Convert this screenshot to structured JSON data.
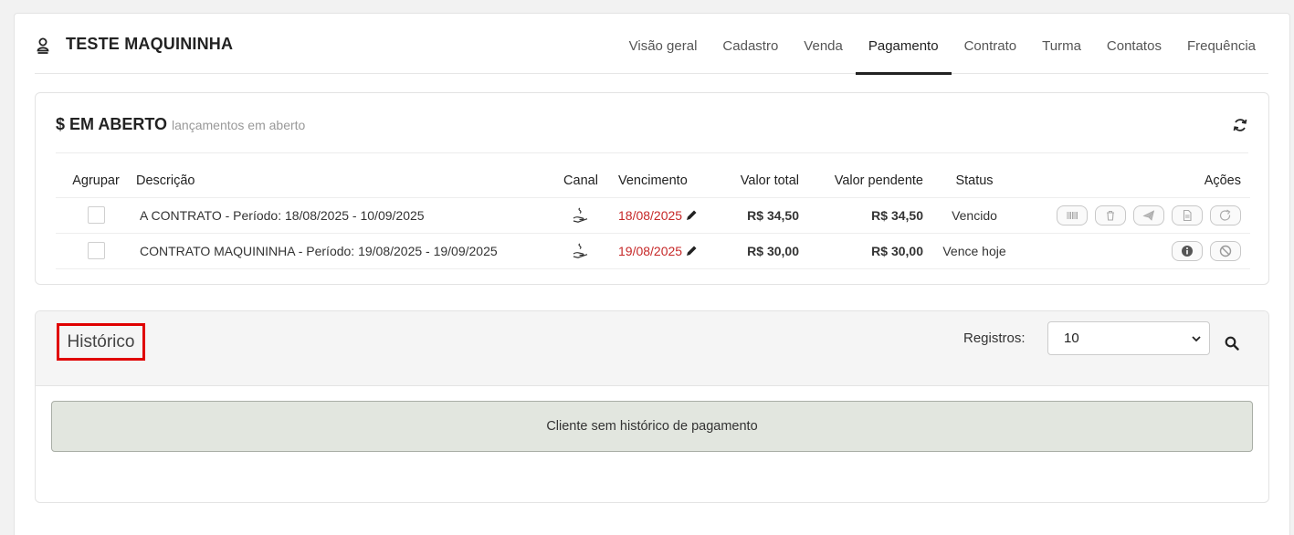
{
  "header": {
    "client_name": "TESTE MAQUININHA",
    "tabs": [
      {
        "label": "Visão geral",
        "active": false
      },
      {
        "label": "Cadastro",
        "active": false
      },
      {
        "label": "Venda",
        "active": false
      },
      {
        "label": "Pagamento",
        "active": true
      },
      {
        "label": "Contrato",
        "active": false
      },
      {
        "label": "Turma",
        "active": false
      },
      {
        "label": "Contatos",
        "active": false
      },
      {
        "label": "Frequência",
        "active": false
      }
    ]
  },
  "open": {
    "title": "$ EM ABERTO",
    "subtitle": "lançamentos em aberto",
    "columns": {
      "agrupar": "Agrupar",
      "descricao": "Descrição",
      "canal": "Canal",
      "vencimento": "Vencimento",
      "valor_total": "Valor total",
      "valor_pendente": "Valor pendente",
      "status": "Status",
      "acoes": "Ações"
    },
    "rows": [
      {
        "descricao": "A CONTRATO - Período: 18/08/2025 - 10/09/2025",
        "vencimento": "18/08/2025",
        "valor_total": "R$ 34,50",
        "valor_pendente": "R$ 34,50",
        "status": "Vencido"
      },
      {
        "descricao": "CONTRATO MAQUININHA - Período: 19/08/2025 - 19/09/2025",
        "vencimento": "19/08/2025",
        "valor_total": "R$ 30,00",
        "valor_pendente": "R$ 30,00",
        "status": "Vence hoje"
      }
    ]
  },
  "history": {
    "title": "Histórico",
    "registros_label": "Registros:",
    "registros_value": "10",
    "empty_message": "Cliente sem histórico de pagamento"
  },
  "colors": {
    "accent_red": "#c62828",
    "highlight_box": "#e00000",
    "empty_bg": "#e2e6df"
  }
}
